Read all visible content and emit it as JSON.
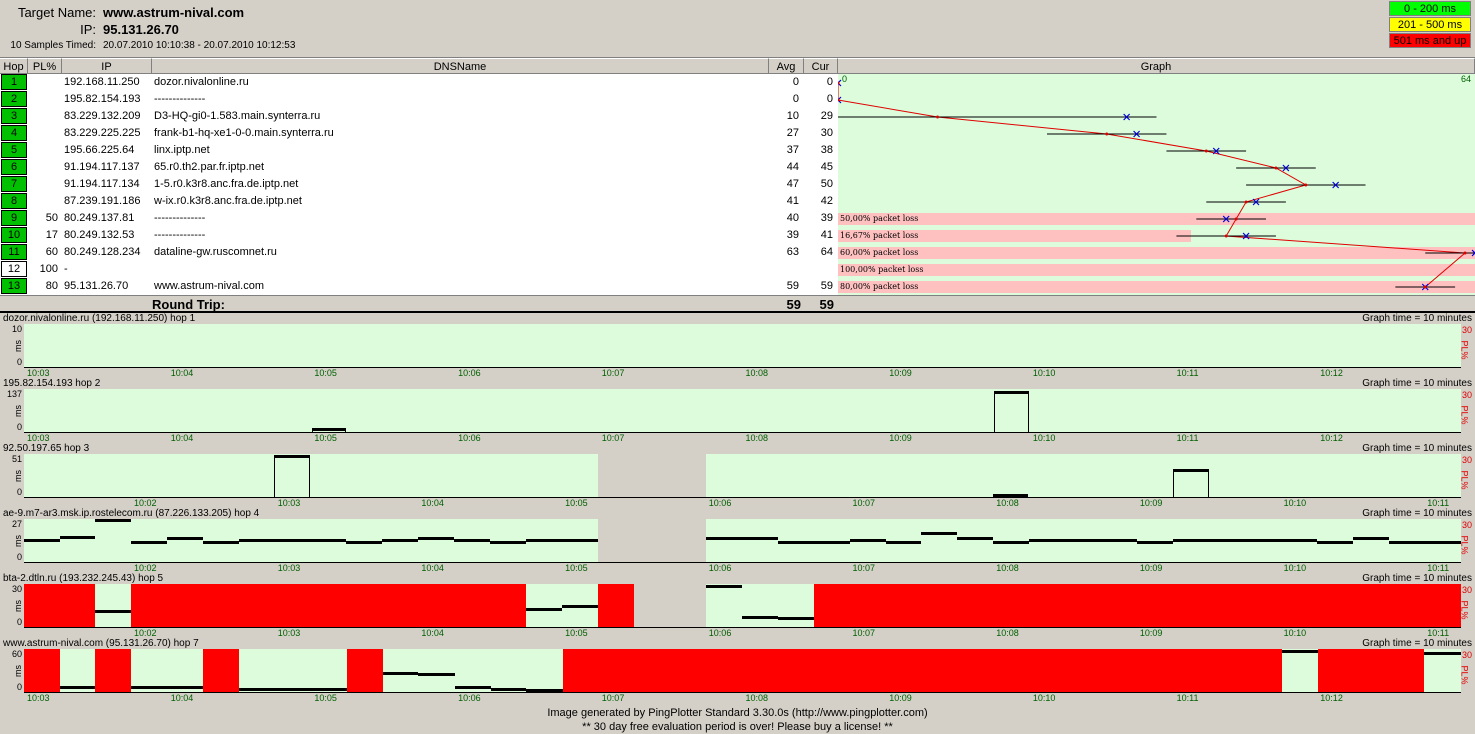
{
  "header": {
    "target_label": "Target Name:",
    "target_value": "www.astrum-nival.com",
    "ip_label": "IP:",
    "ip_value": "95.131.26.70",
    "samples_label": "10 Samples Timed:",
    "samples_value": "20.07.2010 10:10:38 - 20.07.2010 10:12:53"
  },
  "legend": [
    {
      "label": "0 - 200 ms",
      "color": "#00ff00"
    },
    {
      "label": "201 - 500 ms",
      "color": "#ffff00"
    },
    {
      "label": "501 ms and up",
      "color": "#ff0000"
    }
  ],
  "columns": {
    "hop": "Hop",
    "pl": "PL%",
    "ip": "IP",
    "dns": "DNSName",
    "avg": "Avg",
    "cur": "Cur",
    "graph": "Graph"
  },
  "graph_scale": {
    "min": "0",
    "max": "64"
  },
  "hops": [
    {
      "hop": "1",
      "pl": "",
      "ip": "192.168.11.250",
      "dns": "dozor.nivalonline.ru",
      "avg": "0",
      "cur": "0",
      "green": true
    },
    {
      "hop": "2",
      "pl": "",
      "ip": "195.82.154.193",
      "dns": "--------------",
      "avg": "0",
      "cur": "0",
      "green": true
    },
    {
      "hop": "3",
      "pl": "",
      "ip": "83.229.132.209",
      "dns": "D3-HQ-gi0-1.583.main.synterra.ru",
      "avg": "10",
      "cur": "29",
      "green": true
    },
    {
      "hop": "4",
      "pl": "",
      "ip": "83.229.225.225",
      "dns": "frank-b1-hq-xe1-0-0.main.synterra.ru",
      "avg": "27",
      "cur": "30",
      "green": true
    },
    {
      "hop": "5",
      "pl": "",
      "ip": "195.66.225.64",
      "dns": "linx.iptp.net",
      "avg": "37",
      "cur": "38",
      "green": true
    },
    {
      "hop": "6",
      "pl": "",
      "ip": "91.194.117.137",
      "dns": "65.r0.th2.par.fr.iptp.net",
      "avg": "44",
      "cur": "45",
      "green": true
    },
    {
      "hop": "7",
      "pl": "",
      "ip": "91.194.117.134",
      "dns": "1-5.r0.k3r8.anc.fra.de.iptp.net",
      "avg": "47",
      "cur": "50",
      "green": true
    },
    {
      "hop": "8",
      "pl": "",
      "ip": "87.239.191.186",
      "dns": "w-ix.r0.k3r8.anc.fra.de.iptp.net",
      "avg": "41",
      "cur": "42",
      "green": true
    },
    {
      "hop": "9",
      "pl": "50",
      "ip": "80.249.137.81",
      "dns": "--------------",
      "avg": "40",
      "cur": "39",
      "green": true
    },
    {
      "hop": "10",
      "pl": "17",
      "ip": "80.249.132.53",
      "dns": "--------------",
      "avg": "39",
      "cur": "41",
      "green": true
    },
    {
      "hop": "11",
      "pl": "60",
      "ip": "80.249.128.234",
      "dns": "dataline-gw.ruscomnet.ru",
      "avg": "63",
      "cur": "64",
      "green": true
    },
    {
      "hop": "12",
      "pl": "100",
      "ip": "-",
      "dns": "",
      "avg": "",
      "cur": "",
      "green": false
    },
    {
      "hop": "13",
      "pl": "80",
      "ip": "95.131.26.70",
      "dns": "www.astrum-nival.com",
      "avg": "59",
      "cur": "59",
      "green": true
    }
  ],
  "loss_labels": {
    "9": "50,00% packet loss",
    "10": "16,67% packet loss",
    "11": "60,00% packet loss",
    "12": "100,00% packet loss",
    "13": "80,00% packet loss"
  },
  "round_trip": {
    "label": "Round Trip:",
    "avg": "59",
    "cur": "59"
  },
  "panels": [
    {
      "title": "dozor.nivalonline.ru (192.168.11.250) hop 1",
      "time": "Graph time = 10 minutes",
      "ymax": "10",
      "ymin": "0",
      "unit": "ms",
      "pl_max": "30",
      "pl_unit": "PL%",
      "ticks": [
        "10:03",
        "10:04",
        "10:05",
        "10:06",
        "10:07",
        "10:08",
        "10:09",
        "10:10",
        "10:11",
        "10:12"
      ]
    },
    {
      "title": "195.82.154.193 hop 2",
      "time": "Graph time = 10 minutes",
      "ymax": "137",
      "ymin": "0",
      "unit": "ms",
      "pl_max": "30",
      "pl_unit": "PL%",
      "ticks": [
        "10:03",
        "10:04",
        "10:05",
        "10:06",
        "10:07",
        "10:08",
        "10:09",
        "10:10",
        "10:11",
        "10:12"
      ]
    },
    {
      "title": "92.50.197.65 hop 3",
      "time": "Graph time = 10 minutes",
      "ymax": "51",
      "ymin": "0",
      "unit": "ms",
      "pl_max": "30",
      "pl_unit": "PL%",
      "ticks": [
        "10:02",
        "10:03",
        "10:04",
        "10:05",
        "10:06",
        "10:07",
        "10:08",
        "10:09",
        "10:10",
        "10:11"
      ]
    },
    {
      "title": "ae-9.m7-ar3.msk.ip.rostelecom.ru (87.226.133.205) hop 4",
      "time": "Graph time = 10 minutes",
      "ymax": "27",
      "ymin": "0",
      "unit": "ms",
      "pl_max": "30",
      "pl_unit": "PL%",
      "ticks": [
        "10:02",
        "10:03",
        "10:04",
        "10:05",
        "10:06",
        "10:07",
        "10:08",
        "10:09",
        "10:10",
        "10:11"
      ]
    },
    {
      "title": "bta-2.dtln.ru (193.232.245.43) hop 5",
      "time": "Graph time = 10 minutes",
      "ymax": "30",
      "ymin": "0",
      "unit": "ms",
      "pl_max": "30",
      "pl_unit": "PL%",
      "ticks": [
        "10:02",
        "10:03",
        "10:04",
        "10:05",
        "10:06",
        "10:07",
        "10:08",
        "10:09",
        "10:10",
        "10:11"
      ]
    },
    {
      "title": "www.astrum-nival.com (95.131.26.70) hop 7",
      "time": "Graph time = 10 minutes",
      "ymax": "60",
      "ymin": "0",
      "unit": "ms",
      "pl_max": "30",
      "pl_unit": "PL%",
      "ticks": [
        "10:03",
        "10:04",
        "10:05",
        "10:06",
        "10:07",
        "10:08",
        "10:09",
        "10:10",
        "10:11",
        "10:12"
      ]
    }
  ],
  "footer": {
    "line1": "Image generated by PingPlotter Standard 3.30.0s (http://www.pingplotter.com)",
    "line2": "** 30 day free evaluation period is over!  Please buy a license! **"
  }
}
